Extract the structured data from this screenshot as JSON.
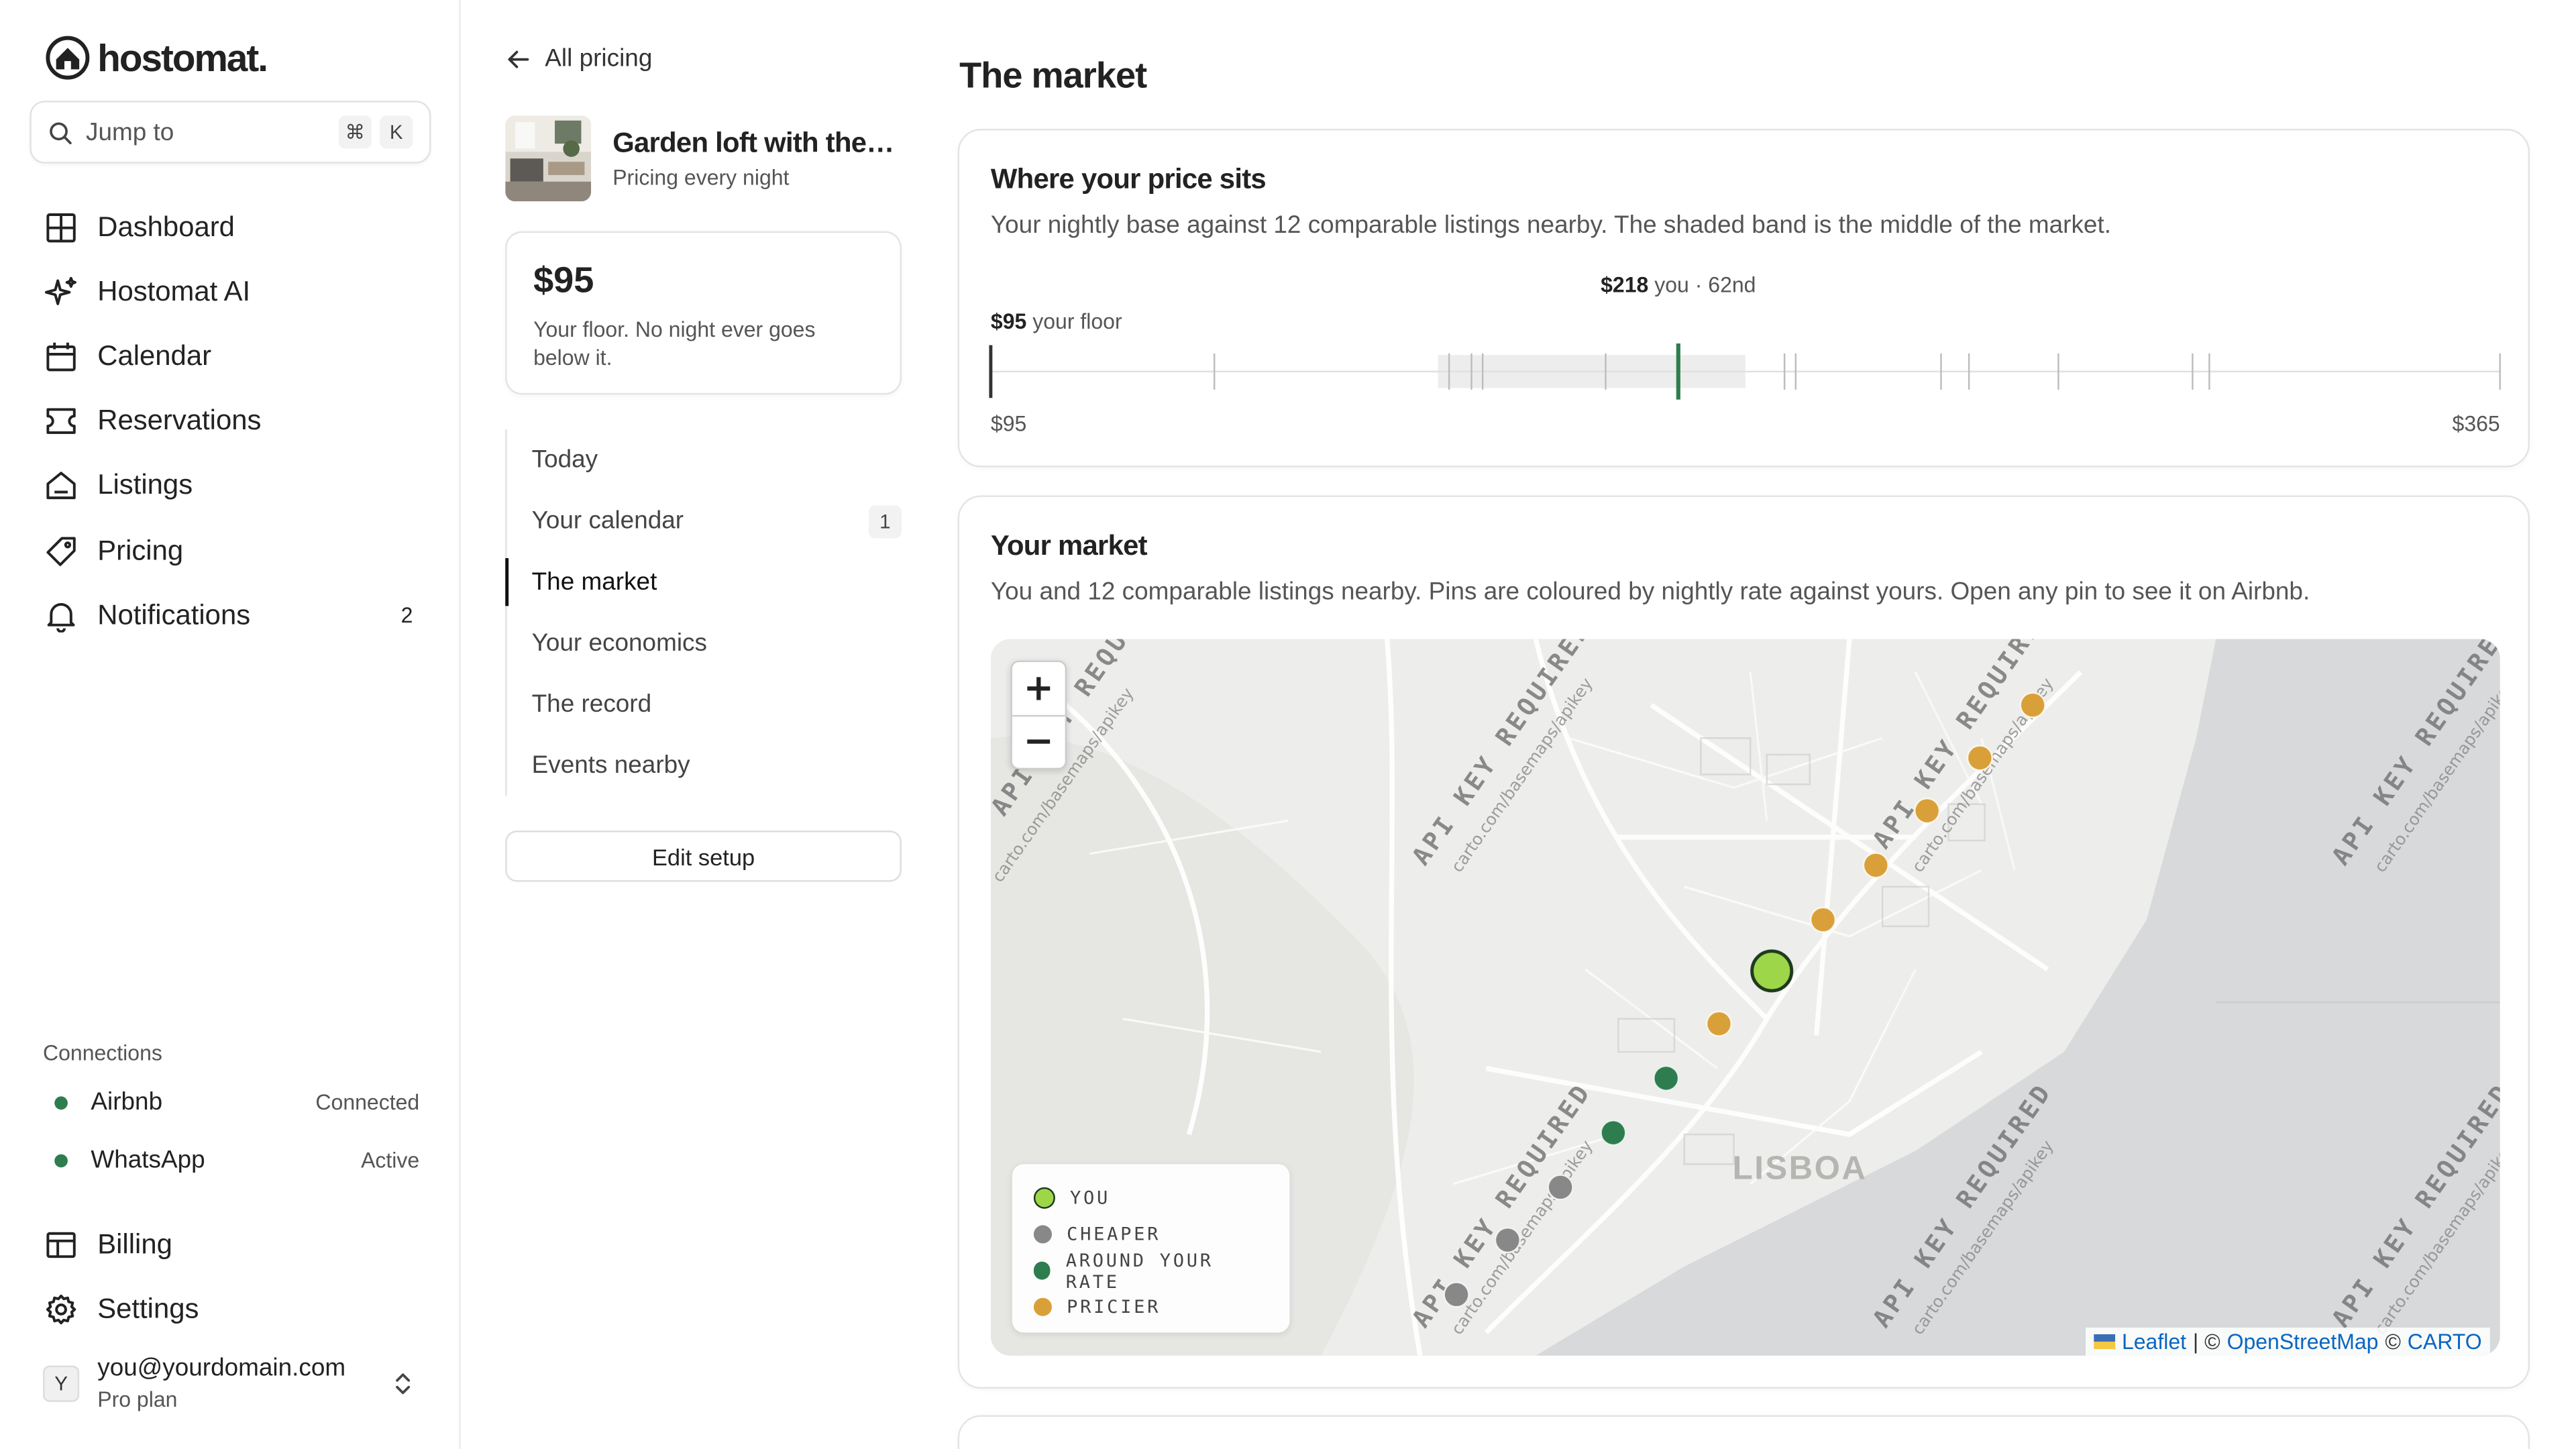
{
  "app": {
    "logo": "hostomat."
  },
  "search": {
    "label": "Jump to",
    "shortcut_mod": "⌘",
    "shortcut_key": "K"
  },
  "nav": [
    {
      "label": "Dashboard",
      "icon": "grid-icon"
    },
    {
      "label": "Hostomat AI",
      "icon": "sparkles-icon"
    },
    {
      "label": "Calendar",
      "icon": "calendar-icon"
    },
    {
      "label": "Reservations",
      "icon": "ticket-icon"
    },
    {
      "label": "Listings",
      "icon": "home-icon"
    },
    {
      "label": "Pricing",
      "icon": "tag-icon"
    },
    {
      "label": "Notifications",
      "icon": "bell-icon",
      "badge": "2"
    }
  ],
  "connections": {
    "title": "Connections",
    "items": [
      {
        "name": "Airbnb",
        "status": "Connected",
        "color": "#2e7d4f"
      },
      {
        "name": "WhatsApp",
        "status": "Active",
        "color": "#2e7d4f"
      }
    ]
  },
  "bottom_nav": [
    {
      "label": "Billing",
      "icon": "billing-icon"
    },
    {
      "label": "Settings",
      "icon": "gear-icon"
    }
  ],
  "user": {
    "initial": "Y",
    "email": "you@yourdomain.com",
    "plan": "Pro plan"
  },
  "middle": {
    "back_label": "All pricing",
    "listing_title": "Garden loft with the l...",
    "listing_sub": "Pricing every night",
    "floor_price": "$95",
    "floor_desc": "Your floor. No night ever goes below it.",
    "subnav": [
      {
        "label": "Today"
      },
      {
        "label": "Your calendar",
        "count": "1"
      },
      {
        "label": "The market",
        "active": true
      },
      {
        "label": "Your economics"
      },
      {
        "label": "The record"
      },
      {
        "label": "Events nearby"
      }
    ],
    "edit_label": "Edit setup"
  },
  "main": {
    "title": "The market",
    "price_card": {
      "title": "Where your price sits",
      "desc": "Your nightly base against 12 comparable listings nearby. The shaded band is the middle of the market.",
      "you_price": "$218",
      "you_suffix": "you · 62nd",
      "floor_price": "$95",
      "floor_suffix": "your floor",
      "min_label": "$95",
      "max_label": "$365"
    },
    "market_card": {
      "title": "Your market",
      "desc": "You and 12 comparable listings nearby. Pins are coloured by nightly rate against yours. Open any pin to see it on Airbnb.",
      "zoom_in": "+",
      "zoom_out": "−",
      "city_label": "LISBOA",
      "tile_watermark": "API KEY REQUIRED",
      "tile_watermark_url": "carto.com/basemaps/apikey",
      "legend": [
        {
          "label": "YOU",
          "color": "#9ed64a"
        },
        {
          "label": "CHEAPER",
          "color": "#888888"
        },
        {
          "label": "AROUND YOUR RATE",
          "color": "#2e7d4f"
        },
        {
          "label": "PRICIER",
          "color": "#d9a03a"
        }
      ],
      "attribution": {
        "leaflet": "Leaflet",
        "sep": "| ©",
        "osm": "OpenStreetMap",
        "c": "©",
        "carto": "CARTO"
      }
    }
  },
  "price_scale": {
    "min": 95,
    "max": 365,
    "floor": 95,
    "you": 218,
    "band_low": 175,
    "band_high": 230,
    "comparables": [
      135,
      177,
      181,
      183,
      205,
      237,
      239,
      265,
      270,
      286,
      310,
      313
    ]
  },
  "map_pins": {
    "you": {
      "color": "#9ed64a"
    },
    "pins": [
      {
        "category": "pricier",
        "color": "#d9a03a"
      },
      {
        "category": "pricier",
        "color": "#d9a03a"
      },
      {
        "category": "pricier",
        "color": "#d9a03a"
      },
      {
        "category": "pricier",
        "color": "#d9a03a"
      },
      {
        "category": "pricier",
        "color": "#d9a03a"
      },
      {
        "category": "pricier",
        "color": "#d9a03a"
      },
      {
        "category": "around",
        "color": "#2e7d4f"
      },
      {
        "category": "around",
        "color": "#2e7d4f"
      },
      {
        "category": "cheaper",
        "color": "#888888"
      },
      {
        "category": "cheaper",
        "color": "#888888"
      },
      {
        "category": "cheaper",
        "color": "#888888"
      }
    ]
  }
}
